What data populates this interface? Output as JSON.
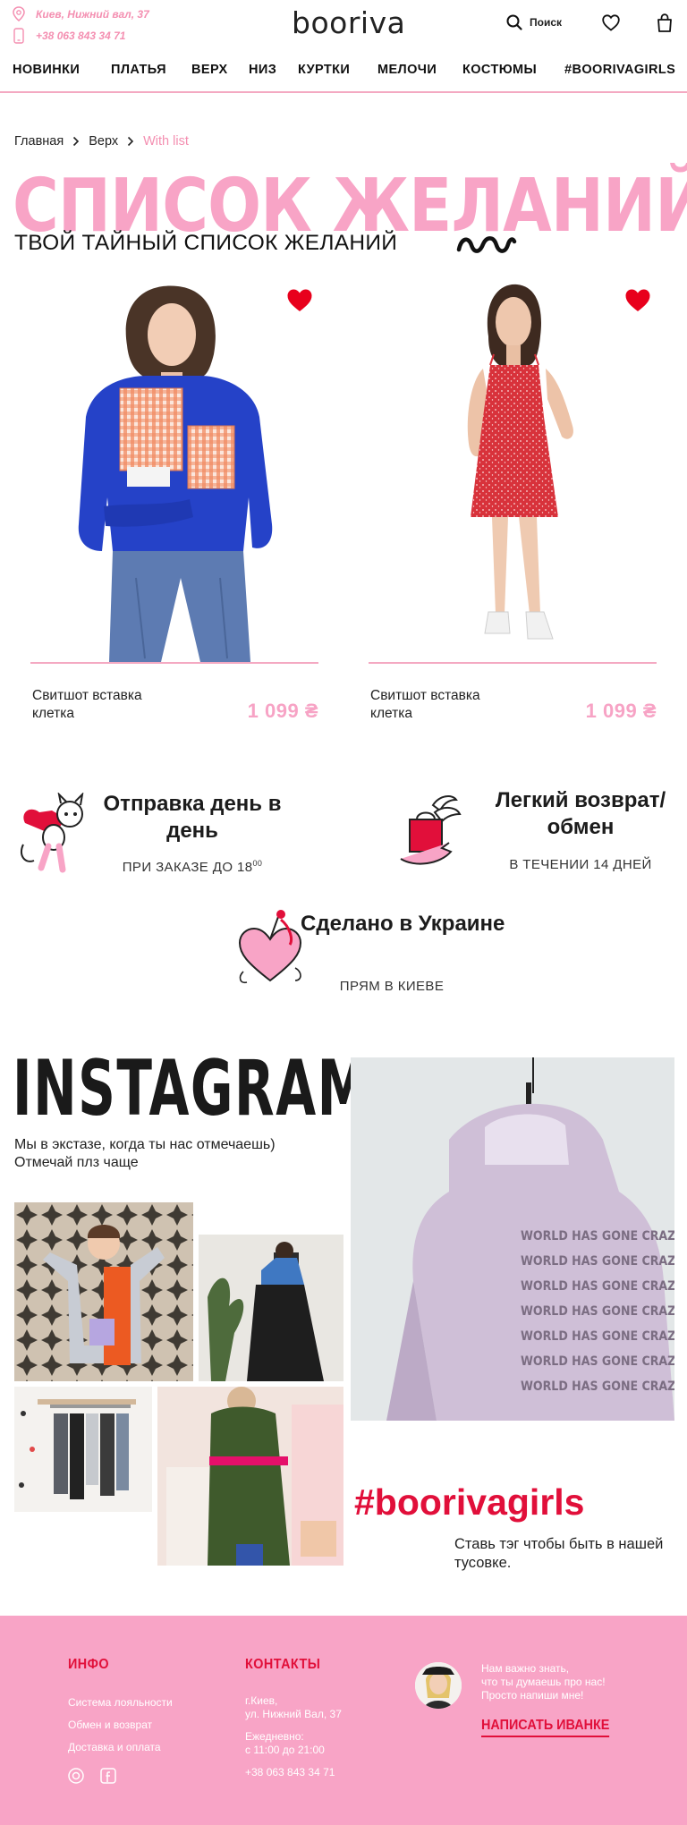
{
  "header": {
    "address": "Киев, Нижний вал, 37",
    "phone": "+38 063 843 34 71",
    "logo": "booriva",
    "search_label": "Поиск"
  },
  "nav": [
    "НОВИНКИ",
    "ПЛАТЬЯ",
    "ВЕРХ",
    "НИЗ",
    "КУРТКИ",
    "МЕЛОЧИ",
    "КОСТЮМЫ",
    "#BOORIVAGIRLS"
  ],
  "breadcrumb": {
    "home": "Главная",
    "section": "Верх",
    "current": "With list"
  },
  "page": {
    "bg_title": "СПИСОК ЖЕЛАНИЙ",
    "title": "ТВОЙ ТАЙНЫЙ СПИСОК ЖЕЛАНИЙ"
  },
  "products": [
    {
      "name": "Свитшот вставка клетка",
      "price": "1 099 ₴"
    },
    {
      "name": "Свитшот вставка клетка",
      "price": "1 099 ₴"
    }
  ],
  "features": [
    {
      "title": "Отправка день в день",
      "subtitle": "ПРИ ЗАКАЗЕ ДО 18",
      "sup": "00"
    },
    {
      "title": "Легкий возврат/обмен",
      "subtitle": "В ТЕЧЕНИИ 14 ДНЕЙ"
    },
    {
      "title": "Сделано в Украине",
      "subtitle": "ПРЯМ В КИЕВЕ"
    }
  ],
  "instagram": {
    "title": "INSTAGRAM",
    "text": "Мы в экстазе, когда ты нас отмечаешь)  Отмечай плз чаще",
    "hoodie_print": "WORLD HAS GONE CRAZY",
    "hashtag": "#boorivagirls",
    "hashtag_note": "Ставь тэг чтобы быть в нашей тусовке."
  },
  "footer": {
    "info_heading": "ИНФО",
    "info_links": [
      "Система лояльности",
      "Обмен и возврат",
      "Доставка и оплата"
    ],
    "contacts_heading": "КОНТАКТЫ",
    "city": "г.Киев,",
    "street": "ул. Нижний Вал, 37",
    "hours_label": "Ежедневно:",
    "hours": "с 11:00 до 21:00",
    "phone": "+38 063 843 34 71",
    "feedback_line1": "Нам важно знать,",
    "feedback_line2": "что ты думаешь про нас!",
    "feedback_line3": "Просто напиши мне!",
    "cta": "НАПИСАТЬ ИВАНКЕ"
  },
  "colors": {
    "accent_pink": "#f8a4c6",
    "accent_red": "#e10f3a",
    "heart_red": "#e8001c"
  }
}
